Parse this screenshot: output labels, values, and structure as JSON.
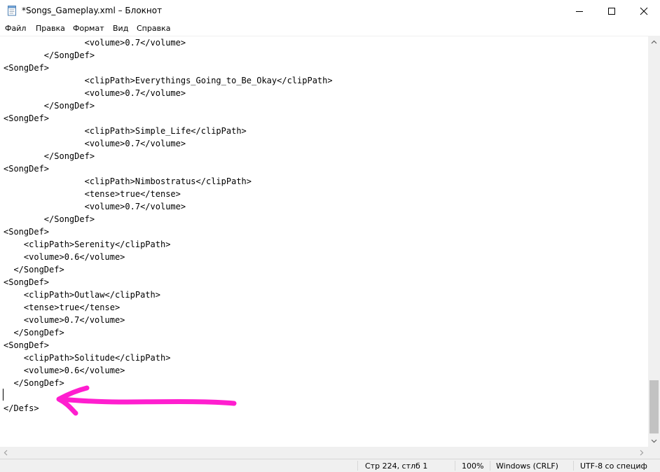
{
  "window": {
    "title": "*Songs_Gameplay.xml – Блокнот",
    "icon": "notepad-icon"
  },
  "menu": [
    {
      "label": "Файл"
    },
    {
      "label": "Правка"
    },
    {
      "label": "Формат"
    },
    {
      "label": "Вид"
    },
    {
      "label": "Справка"
    }
  ],
  "editor": {
    "lines": [
      "                <volume>0.7</volume>",
      "        </SongDef>",
      "<SongDef>",
      "                <clipPath>Everythings_Going_to_Be_Okay</clipPath>",
      "                <volume>0.7</volume>",
      "        </SongDef>",
      "<SongDef>",
      "                <clipPath>Simple_Life</clipPath>",
      "                <volume>0.7</volume>",
      "        </SongDef>",
      "<SongDef>",
      "                <clipPath>Nimbostratus</clipPath>",
      "                <tense>true</tense>",
      "                <volume>0.7</volume>",
      "        </SongDef>",
      "<SongDef>",
      "    <clipPath>Serenity</clipPath>",
      "    <volume>0.6</volume>",
      "  </SongDef>",
      "<SongDef>",
      "    <clipPath>Outlaw</clipPath>",
      "    <tense>true</tense>",
      "    <volume>0.7</volume>",
      "  </SongDef>",
      "<SongDef>",
      "    <clipPath>Solitude</clipPath>",
      "    <volume>0.6</volume>",
      "  </SongDef>",
      "",
      "</Defs>"
    ]
  },
  "annotation": {
    "color": "#ff1ecf",
    "icon": "arrow-left-annotation"
  },
  "status": {
    "position": "Стр 224, стлб 1",
    "zoom": "100%",
    "line_ending": "Windows (CRLF)",
    "encoding": "UTF-8 со специф"
  }
}
